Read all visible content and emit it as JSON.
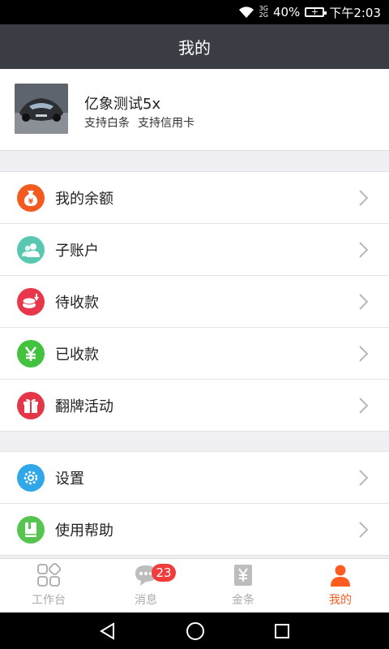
{
  "status_bar": {
    "network_top": "3G",
    "network_bottom": "2G",
    "battery_percent": "40%",
    "time": "下午2:03",
    "icons": [
      "wifi-icon",
      "battery-icon"
    ]
  },
  "header": {
    "title": "我的"
  },
  "profile": {
    "name": "亿象测试5x",
    "tags": [
      "支持白条",
      "支持信用卡"
    ]
  },
  "menu_group_1": [
    {
      "label": "我的余额",
      "icon": "money-bag-icon",
      "color": "#f25a1f"
    },
    {
      "label": "子账户",
      "icon": "users-icon",
      "color": "#5ac8b1"
    },
    {
      "label": "待收款",
      "icon": "coins-down-icon",
      "color": "#e8364a"
    },
    {
      "label": "已收款",
      "icon": "yen-icon",
      "color": "#43c23e"
    },
    {
      "label": "翻牌活动",
      "icon": "gift-icon",
      "color": "#e53549"
    }
  ],
  "menu_group_2": [
    {
      "label": "设置",
      "icon": "gear-icon",
      "color": "#2fa7e8"
    },
    {
      "label": "使用帮助",
      "icon": "help-book-icon",
      "color": "#56c54f"
    }
  ],
  "tab_bar": {
    "tabs": [
      {
        "label": "工作台",
        "icon": "workbench-icon",
        "active": false
      },
      {
        "label": "消息",
        "icon": "chat-bubble-icon",
        "active": false,
        "badge": "23"
      },
      {
        "label": "金条",
        "icon": "yen-card-icon",
        "active": false
      },
      {
        "label": "我的",
        "icon": "person-icon",
        "active": true
      }
    ],
    "active_color": "#ff5a1f",
    "inactive_color": "#aaaaaa"
  },
  "nav_bar": {
    "icons": [
      "back-icon",
      "home-icon",
      "recents-icon"
    ]
  },
  "colors": {
    "title_bar": "#3b3d45",
    "badge": "#f23b3b"
  }
}
